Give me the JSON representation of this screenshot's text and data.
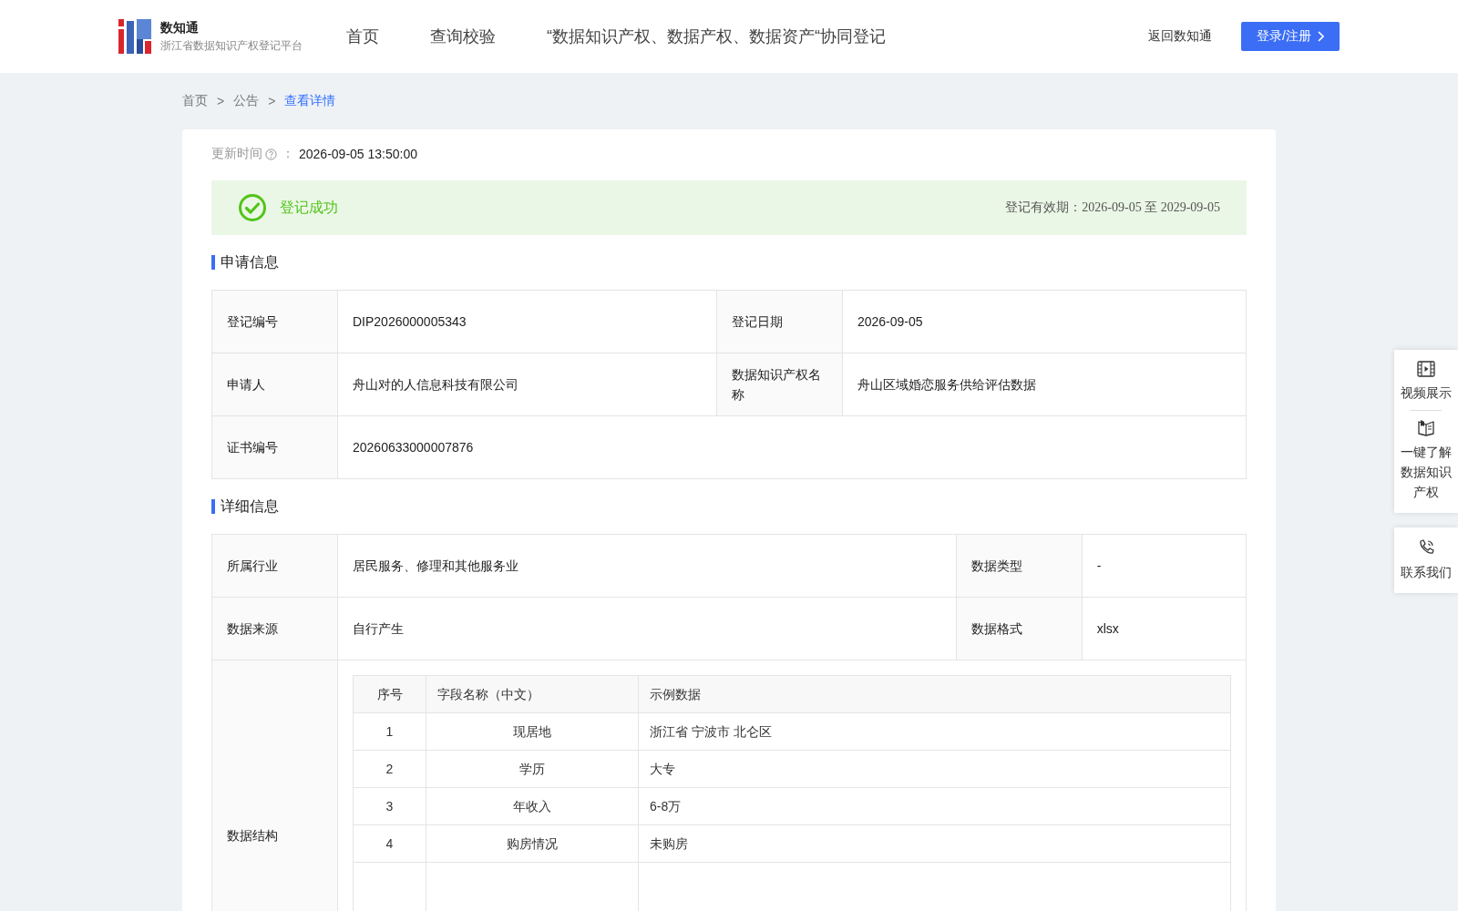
{
  "header": {
    "logo_title": "数知通",
    "logo_subtitle": "浙江省数据知识产权登记平台",
    "nav": [
      {
        "label": "首页",
        "selected": false
      },
      {
        "label": "查询校验",
        "selected": false
      },
      {
        "label": "“数据知识产权、数据产权、数据资产“协同登记",
        "selected": false
      }
    ],
    "back_link": "返回数知通",
    "login_button": "登录/注册"
  },
  "breadcrumb": [
    {
      "label": "首页",
      "selected": false
    },
    {
      "label": "公告",
      "selected": false
    },
    {
      "label": "查看详情",
      "selected": true
    }
  ],
  "breadcrumb_separator": ">",
  "update": {
    "label": "更新时间",
    "colon": "：",
    "value": "2026-09-05 13:50:00"
  },
  "status": {
    "text": "登记成功",
    "validity": "登记有效期：2026-09-05 至 2029-09-05"
  },
  "sections": [
    {
      "title": "申请信息",
      "rows": [
        [
          {
            "label": "登记编号",
            "value": "DIP2026000005343"
          },
          {
            "label": "登记日期",
            "value": "2026-09-05"
          }
        ],
        [
          {
            "label": "申请人",
            "value": "舟山对的人信息科技有限公司"
          },
          {
            "label": "数据知识产权名称",
            "value": "舟山区域婚恋服务供给评估数据"
          }
        ],
        [
          {
            "label": "证书编号",
            "value": "20260633000007876"
          }
        ]
      ]
    },
    {
      "title": "详细信息",
      "rows": [
        [
          {
            "label": "所属行业",
            "value": "居民服务、修理和其他服务业"
          },
          {
            "label": "数据类型",
            "value": "-"
          }
        ],
        [
          {
            "label": "数据来源",
            "value": "自行产生"
          },
          {
            "label": "数据格式",
            "value": "xlsx"
          }
        ]
      ],
      "structure": {
        "label": "数据结构",
        "columns": [
          "序号",
          "字段名称（中文）",
          "示例数据"
        ],
        "rows": [
          [
            "1",
            "现居地",
            "浙江省 宁波市 北仑区"
          ],
          [
            "2",
            "学历",
            "大专"
          ],
          [
            "3",
            "年收入",
            "6-8万"
          ],
          [
            "4",
            "购房情况",
            "未购房"
          ]
        ]
      }
    }
  ],
  "side_panel": [
    {
      "kind": "video",
      "label": "视频展示"
    },
    {
      "kind": "book",
      "label": "一键了解数据知识产权"
    },
    {
      "kind": "phone",
      "label": "联系我们"
    }
  ]
}
